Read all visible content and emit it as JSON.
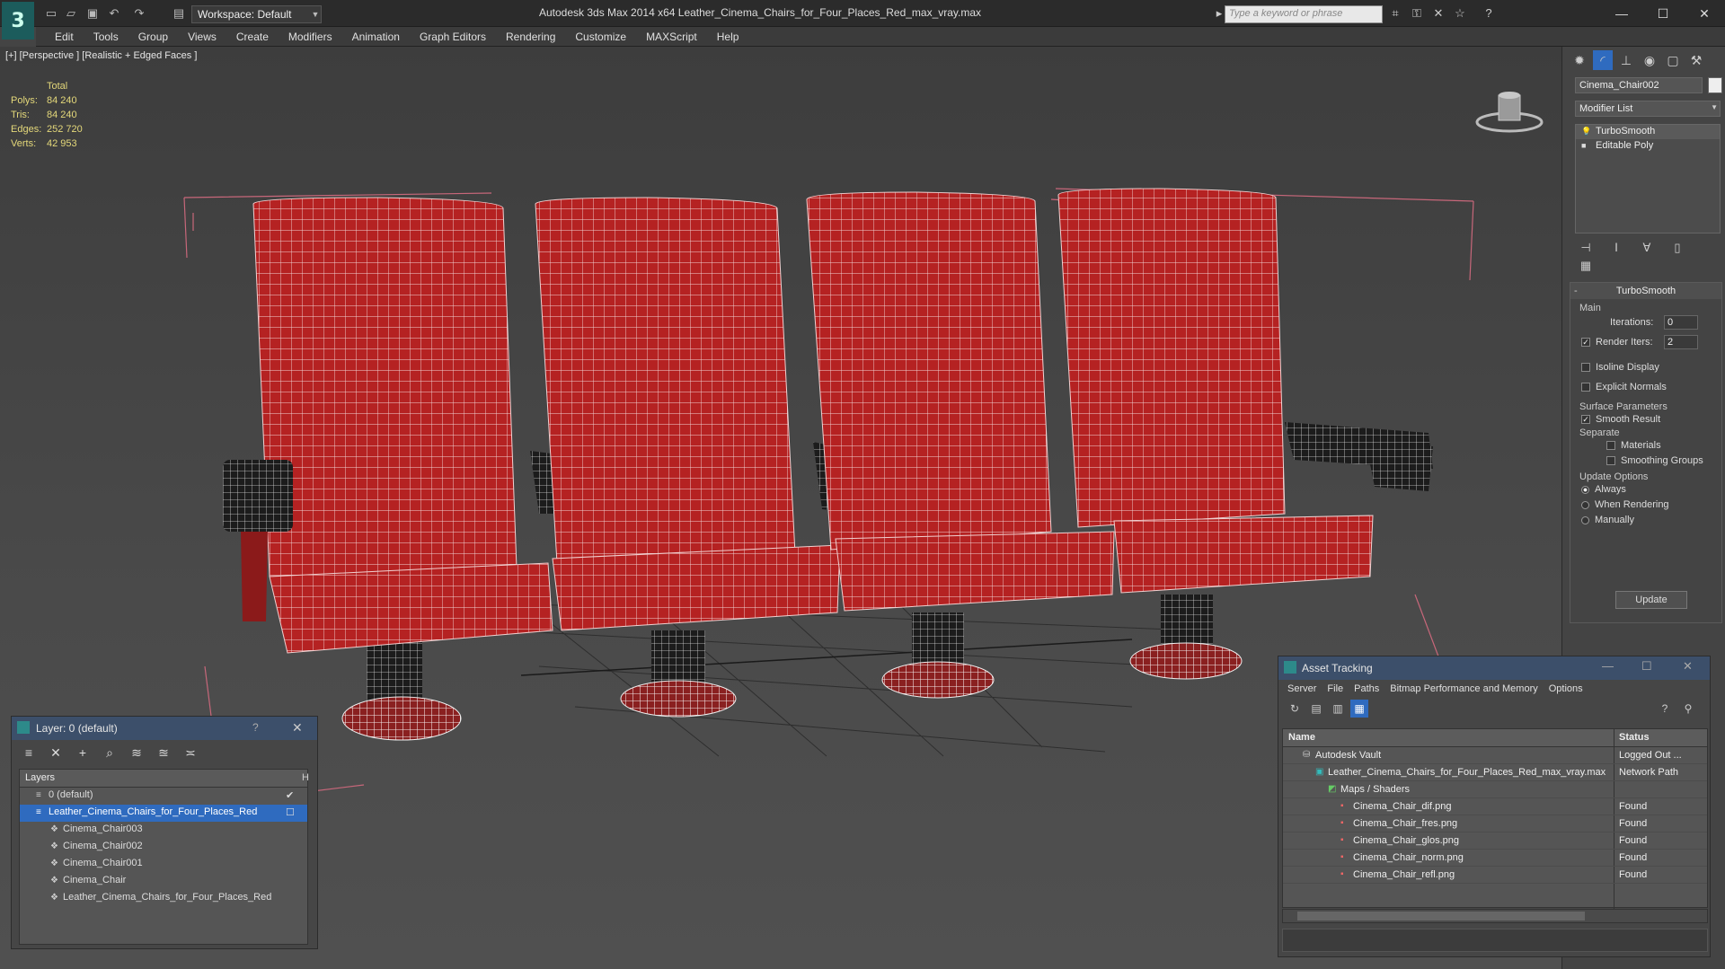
{
  "titlebar": {
    "workspace_label": "Workspace: Default",
    "title": "Autodesk 3ds Max  2014 x64      Leather_Cinema_Chairs_for_Four_Places_Red_max_vray.max",
    "search_placeholder": "Type a keyword or phrase",
    "logo": "3"
  },
  "menu": [
    "Edit",
    "Tools",
    "Group",
    "Views",
    "Create",
    "Modifiers",
    "Animation",
    "Graph Editors",
    "Rendering",
    "Customize",
    "MAXScript",
    "Help"
  ],
  "viewport": {
    "label": "[+] [Perspective ] [Realistic + Edged Faces ]",
    "stats": {
      "header": "Total",
      "rows": [
        {
          "k": "Polys:",
          "v": "84 240"
        },
        {
          "k": "Tris:",
          "v": "84 240"
        },
        {
          "k": "Edges:",
          "v": "252 720"
        },
        {
          "k": "Verts:",
          "v": "42 953"
        }
      ]
    }
  },
  "command_panel": {
    "object_name": "Cinema_Chair002",
    "modifier_list": "Modifier List",
    "stack": [
      "TurboSmooth",
      "Editable Poly"
    ],
    "turbosmooth": {
      "title": "TurboSmooth",
      "main_label": "Main",
      "iterations_label": "Iterations:",
      "iterations": "0",
      "render_iters_label": "Render Iters:",
      "render_iters": "2",
      "isoline": "Isoline Display",
      "explicit_normals": "Explicit Normals",
      "surface_params": "Surface Parameters",
      "smooth_result": "Smooth Result",
      "separate": "Separate",
      "materials": "Materials",
      "smoothing_groups": "Smoothing Groups",
      "update_options": "Update Options",
      "always": "Always",
      "when_rendering": "When Rendering",
      "manually": "Manually",
      "update_button": "Update"
    }
  },
  "layer_panel": {
    "title": "Layer: 0 (default)",
    "help": "?",
    "header": "Layers",
    "header_right": "H",
    "rows": [
      {
        "name": "0 (default)",
        "indent": 1
      },
      {
        "name": "Leather_Cinema_Chairs_for_Four_Places_Red",
        "indent": 1
      },
      {
        "name": "Cinema_Chair003",
        "indent": 2
      },
      {
        "name": "Cinema_Chair002",
        "indent": 2
      },
      {
        "name": "Cinema_Chair001",
        "indent": 2
      },
      {
        "name": "Cinema_Chair",
        "indent": 2
      },
      {
        "name": "Leather_Cinema_Chairs_for_Four_Places_Red",
        "indent": 2
      }
    ]
  },
  "asset_panel": {
    "title": "Asset Tracking",
    "menu": [
      "Server",
      "File",
      "Paths",
      "Bitmap Performance and Memory",
      "Options"
    ],
    "col_name": "Name",
    "col_status": "Status",
    "rows": [
      {
        "name": "Autodesk Vault",
        "status": "Logged Out ...",
        "indent": 1
      },
      {
        "name": "Leather_Cinema_Chairs_for_Four_Places_Red_max_vray.max",
        "status": "Network Path",
        "indent": 2
      },
      {
        "name": "Maps / Shaders",
        "status": "",
        "indent": 3
      },
      {
        "name": "Cinema_Chair_dif.png",
        "status": "Found",
        "indent": 4
      },
      {
        "name": "Cinema_Chair_fres.png",
        "status": "Found",
        "indent": 4
      },
      {
        "name": "Cinema_Chair_glos.png",
        "status": "Found",
        "indent": 4
      },
      {
        "name": "Cinema_Chair_norm.png",
        "status": "Found",
        "indent": 4
      },
      {
        "name": "Cinema_Chair_refl.png",
        "status": "Found",
        "indent": 4
      }
    ]
  },
  "colors": {
    "accent": "#2f6bbf",
    "seat_red": "#b52222",
    "stat_text": "#e4d87a",
    "bbox": "#c7677a"
  }
}
